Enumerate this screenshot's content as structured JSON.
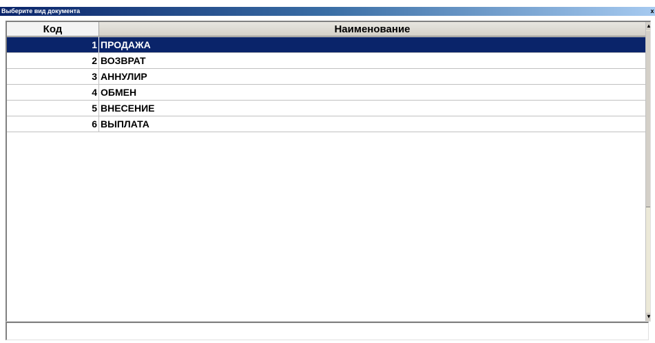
{
  "window": {
    "title": "Выберите вид документа",
    "close_glyph": "x"
  },
  "grid": {
    "columns": [
      {
        "key": "code",
        "label": "Код"
      },
      {
        "key": "name",
        "label": "Наименование"
      }
    ],
    "rows": [
      {
        "code": "1",
        "name": "ПРОДАЖА",
        "selected": true
      },
      {
        "code": "2",
        "name": "ВОЗВРАТ",
        "selected": false
      },
      {
        "code": "3",
        "name": "АННУЛИР",
        "selected": false
      },
      {
        "code": "4",
        "name": "ОБМЕН",
        "selected": false
      },
      {
        "code": "5",
        "name": "ВНЕСЕНИЕ",
        "selected": false
      },
      {
        "code": "6",
        "name": "ВЫПЛАТА",
        "selected": false
      }
    ],
    "selected_color": "#0a246a"
  },
  "scrollbar": {
    "up_glyph": "▲",
    "down_glyph": "▼"
  },
  "statusbar": {
    "text": ""
  }
}
